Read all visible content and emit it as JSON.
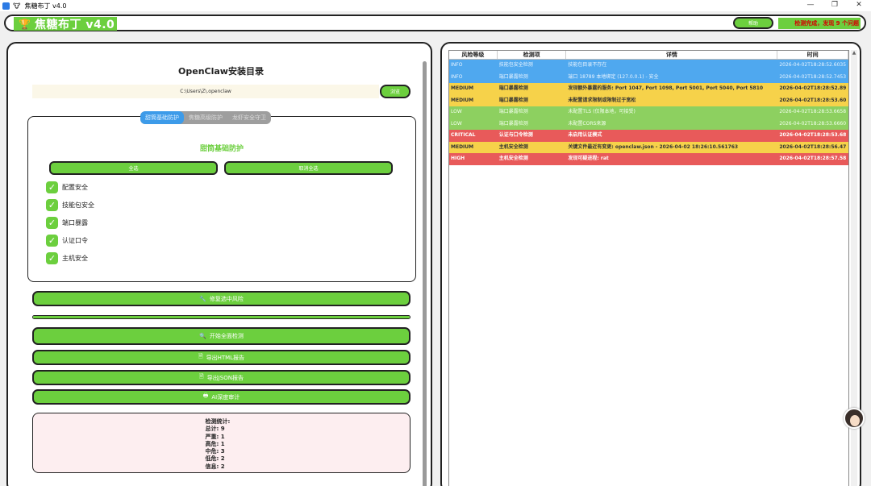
{
  "window": {
    "title": "焦糖布丁 v4.0",
    "title_glyph": "🐮",
    "controls": [
      "—",
      "❐",
      "✕"
    ]
  },
  "header": {
    "logo_glyph": "🏆",
    "app_name": "焦糖布丁 v4.0",
    "help_label": "帮助",
    "status_text": "检测完成，发现 9 个问题"
  },
  "left": {
    "install_title": "OpenClaw安装目录",
    "install_path": "C:\\Users\\Z\\.openclaw",
    "browse_label": "浏览",
    "tabs": [
      {
        "label": "甜筒基础防护",
        "active": true
      },
      {
        "label": "焦糖高级防护",
        "active": false
      },
      {
        "label": "龙虾安全守卫",
        "active": false
      }
    ],
    "section_title": "甜筒基础防护",
    "select_all_label": "全选",
    "deselect_all_label": "取消全选",
    "checks": [
      {
        "label": "配置安全",
        "checked": true
      },
      {
        "label": "技能包安全",
        "checked": true
      },
      {
        "label": "端口暴露",
        "checked": true
      },
      {
        "label": "认证口令",
        "checked": true
      },
      {
        "label": "主机安全",
        "checked": true
      }
    ],
    "fix_label": "修复选中风险",
    "progress": 1.0,
    "start_scan_label": "开始全面检测",
    "export_html_label": "导出HTML报告",
    "export_json_label": "导出JSON报告",
    "ai_audit_label": "AI深度审计",
    "stats": [
      "检测统计:",
      "总计: 9",
      "严重: 1",
      "高危: 1",
      "中危: 3",
      "低危: 2",
      "信息: 2"
    ]
  },
  "table": {
    "columns": [
      "风险等级",
      "检测项",
      "详情",
      "时间"
    ],
    "rows": [
      {
        "level": "INFO",
        "cls": "info",
        "item": "技能包安全检测",
        "detail": "技能包目录不存在",
        "time": "2026-04-02T18:28:52.6035"
      },
      {
        "level": "INFO",
        "cls": "info",
        "item": "端口暴露检测",
        "detail": "端口 18789 本地绑定 (127.0.0.1) - 安全",
        "time": "2026-04-02T18:28:52.7453"
      },
      {
        "level": "MEDIUM",
        "cls": "medium",
        "item": "端口暴露检测",
        "detail": "发现额外暴露的服务: Port 1047, Port 1098, Port 5001, Port 5040, Port 5810",
        "time": "2026-04-02T18:28:52.89"
      },
      {
        "level": "MEDIUM",
        "cls": "medium",
        "item": "端口暴露检测",
        "detail": "未配置请求限制或限制过于宽松",
        "time": "2026-04-02T18:28:53.60"
      },
      {
        "level": "LOW",
        "cls": "low",
        "item": "端口暴露检测",
        "detail": "未配置TLS (仅限本地，可接受)",
        "time": "2026-04-02T18:28:53.6658"
      },
      {
        "level": "LOW",
        "cls": "low",
        "item": "端口暴露检测",
        "detail": "未配置CORS来源",
        "time": "2026-04-02T18:28:53.6660"
      },
      {
        "level": "CRITICAL",
        "cls": "critical",
        "item": "认证与口令检测",
        "detail": "未启用认证模式",
        "time": "2026-04-02T18:28:53.68"
      },
      {
        "level": "MEDIUM",
        "cls": "medium",
        "item": "主机安全检测",
        "detail": "关键文件最近有变更: openclaw.json - 2026-04-02 18:26:10.561763",
        "time": "2026-04-02T18:28:56.47"
      },
      {
        "level": "HIGH",
        "cls": "high",
        "item": "主机安全检测",
        "detail": "发现可疑进程: rat",
        "time": "2026-04-02T18:28:57.58"
      }
    ]
  },
  "colors": {
    "accent_green": "#6ccf3e",
    "info": "#4fa8ef",
    "medium": "#f6d24a",
    "low": "#8dd060",
    "critical": "#e85a5a",
    "status_red": "#d40000"
  }
}
